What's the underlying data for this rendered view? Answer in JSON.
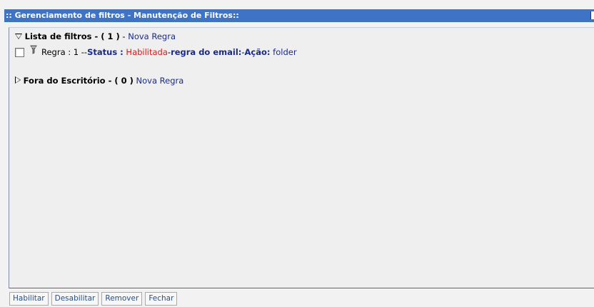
{
  "window": {
    "title": ":: Gerenciamento de filtros - Manutenção de Filtros::",
    "accent_color": "#3e73c6"
  },
  "sections": {
    "filters": {
      "title": "Lista de filtros",
      "separator": " - ",
      "count": "( 1 )",
      "dash": " - ",
      "new_rule": "Nova Regra",
      "expanded": true,
      "toggle_icon": "triangle-down-icon"
    },
    "out_of_office": {
      "title": "Fora do Escritório",
      "separator": " - ",
      "count": "( 0 )",
      "new_rule": "Nova Regra",
      "expanded": false,
      "toggle_icon": "triangle-right-icon"
    }
  },
  "rules": [
    {
      "icon": "filter-funnel-icon",
      "label": "Regra : 1 -- ",
      "status_label": "Status :",
      "status_value": "Habilitada",
      "mid_sep": " - ",
      "email_label": "regra do email:",
      "action_sep": " - ",
      "action_label": "Ação:",
      "action_value": "folder",
      "checked": false,
      "status_color": "#e31414"
    }
  ],
  "footer": {
    "enable": "Habilitar",
    "disable": "Desabilitar",
    "remove": "Remover",
    "close": "Fechar"
  }
}
